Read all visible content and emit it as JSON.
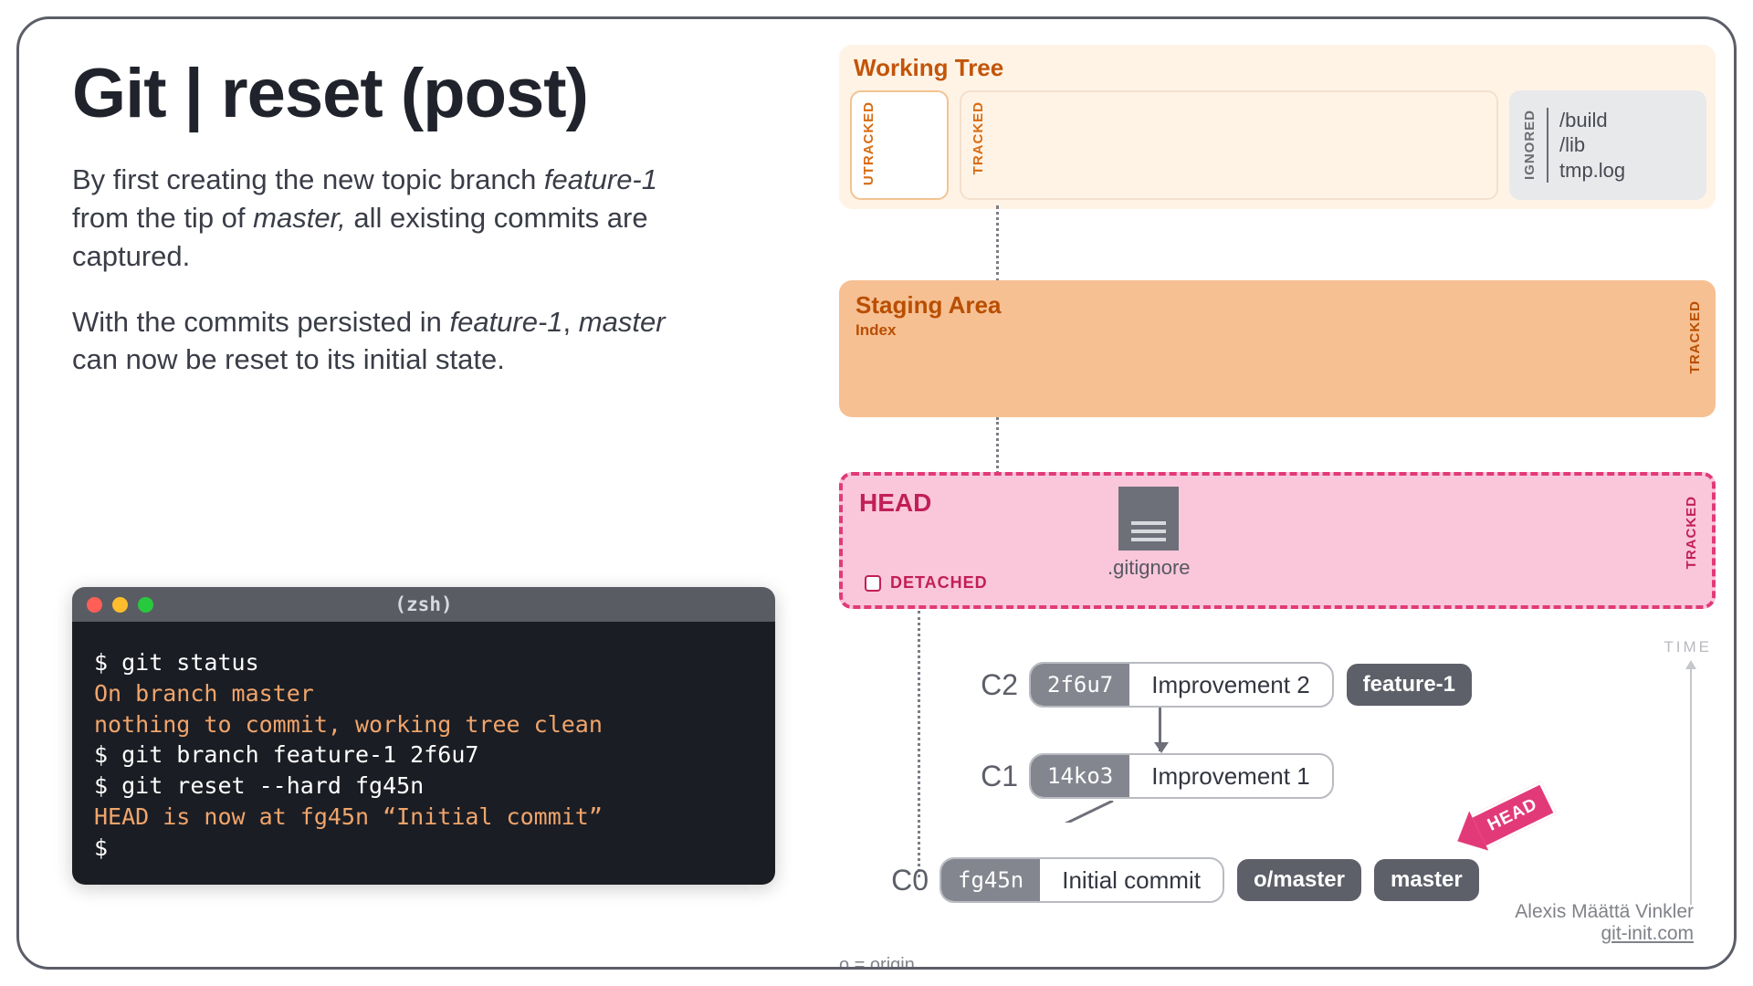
{
  "title": "Git | reset (post)",
  "paragraphs": {
    "p1a": "By first creating the new topic branch ",
    "p1_em1": "feature-1",
    "p1b": " from the tip of ",
    "p1_em2": "master,",
    "p1c": " all existing commits are captured.",
    "p2a": "With the commits persisted in ",
    "p2_em1": "feature-1",
    "p2b": ", ",
    "p2_em2": "master",
    "p2c": " can now be reset to its initial state."
  },
  "terminal": {
    "shell": "(zsh)",
    "lines": {
      "l1": "$ git status",
      "l2": "On branch master",
      "l3": "nothing to commit, working tree clean",
      "l4": "$ git branch feature-1 2f6u7",
      "l5": "$ git reset --hard fg45n",
      "l6": "HEAD is now at fg45n “Initial commit”",
      "l7": "$"
    }
  },
  "working_tree": {
    "title": "Working Tree",
    "utracked_label": "UTRACKED",
    "tracked_label": "TRACKED",
    "ignored_label": "IGNORED",
    "ignored_files": {
      "f1": "/build",
      "f2": "/lib",
      "f3": "tmp.log"
    }
  },
  "staging": {
    "title": "Staging Area",
    "subtitle": "Index",
    "tracked_label": "TRACKED"
  },
  "head": {
    "title": "HEAD",
    "detached": "DETACHED",
    "file": ".gitignore",
    "tracked_label": "TRACKED",
    "arrow_text": "HEAD"
  },
  "commits": {
    "time_label": "TIME",
    "c2": {
      "num": "C2",
      "hash": "2f6u7",
      "msg": "Improvement 2",
      "branch": "feature-1"
    },
    "c1": {
      "num": "C1",
      "hash": "14ko3",
      "msg": "Improvement 1"
    },
    "c0": {
      "num": "C0",
      "hash": "fg45n",
      "msg": "Initial commit",
      "remote": "o/master",
      "branch": "master"
    },
    "origin_note": "o = origin"
  },
  "attribution": {
    "author": "Alexis Määttä Vinkler",
    "site": "git-init.com"
  }
}
